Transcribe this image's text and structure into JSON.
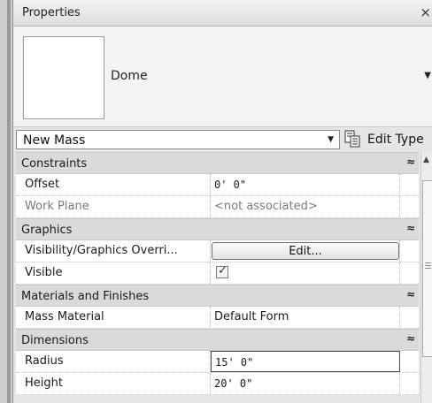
{
  "panel": {
    "title": "Properties",
    "close_glyph": "×"
  },
  "type_selector": {
    "family_type": "Dome",
    "dropdown_glyph": "▼"
  },
  "instance_selector": {
    "value": "New Mass",
    "dropdown_glyph": "▼",
    "edit_type_label": "Edit Type",
    "edit_type_icon": "edit-type-icon"
  },
  "groups": {
    "constraints": {
      "title": "Constraints",
      "collapse_glyph": "≈"
    },
    "graphics": {
      "title": "Graphics",
      "collapse_glyph": "≈"
    },
    "materials": {
      "title": "Materials and Finishes",
      "collapse_glyph": "≈"
    },
    "dimensions": {
      "title": "Dimensions",
      "collapse_glyph": "≈"
    }
  },
  "properties": {
    "offset": {
      "name": "Offset",
      "value": "0'  0\""
    },
    "work_plane": {
      "name": "Work Plane",
      "value": "<not associated>"
    },
    "visibility_overrides": {
      "name": "Visibility/Graphics Overri...",
      "button": "Edit..."
    },
    "visible": {
      "name": "Visible",
      "checked": true,
      "check_glyph": "✓"
    },
    "mass_material": {
      "name": "Mass Material",
      "value": "Default Form"
    },
    "radius": {
      "name": "Radius",
      "value": "15'  0\""
    },
    "height": {
      "name": "Height",
      "value": "20'  0\""
    }
  },
  "scrollbar": {
    "up_glyph": "▲"
  },
  "colors": {
    "panel_bg": "#e6e6e6",
    "group_header_bg": "#dadada",
    "row_bg": "#ffffff",
    "disabled_text": "#7a7a7a"
  }
}
